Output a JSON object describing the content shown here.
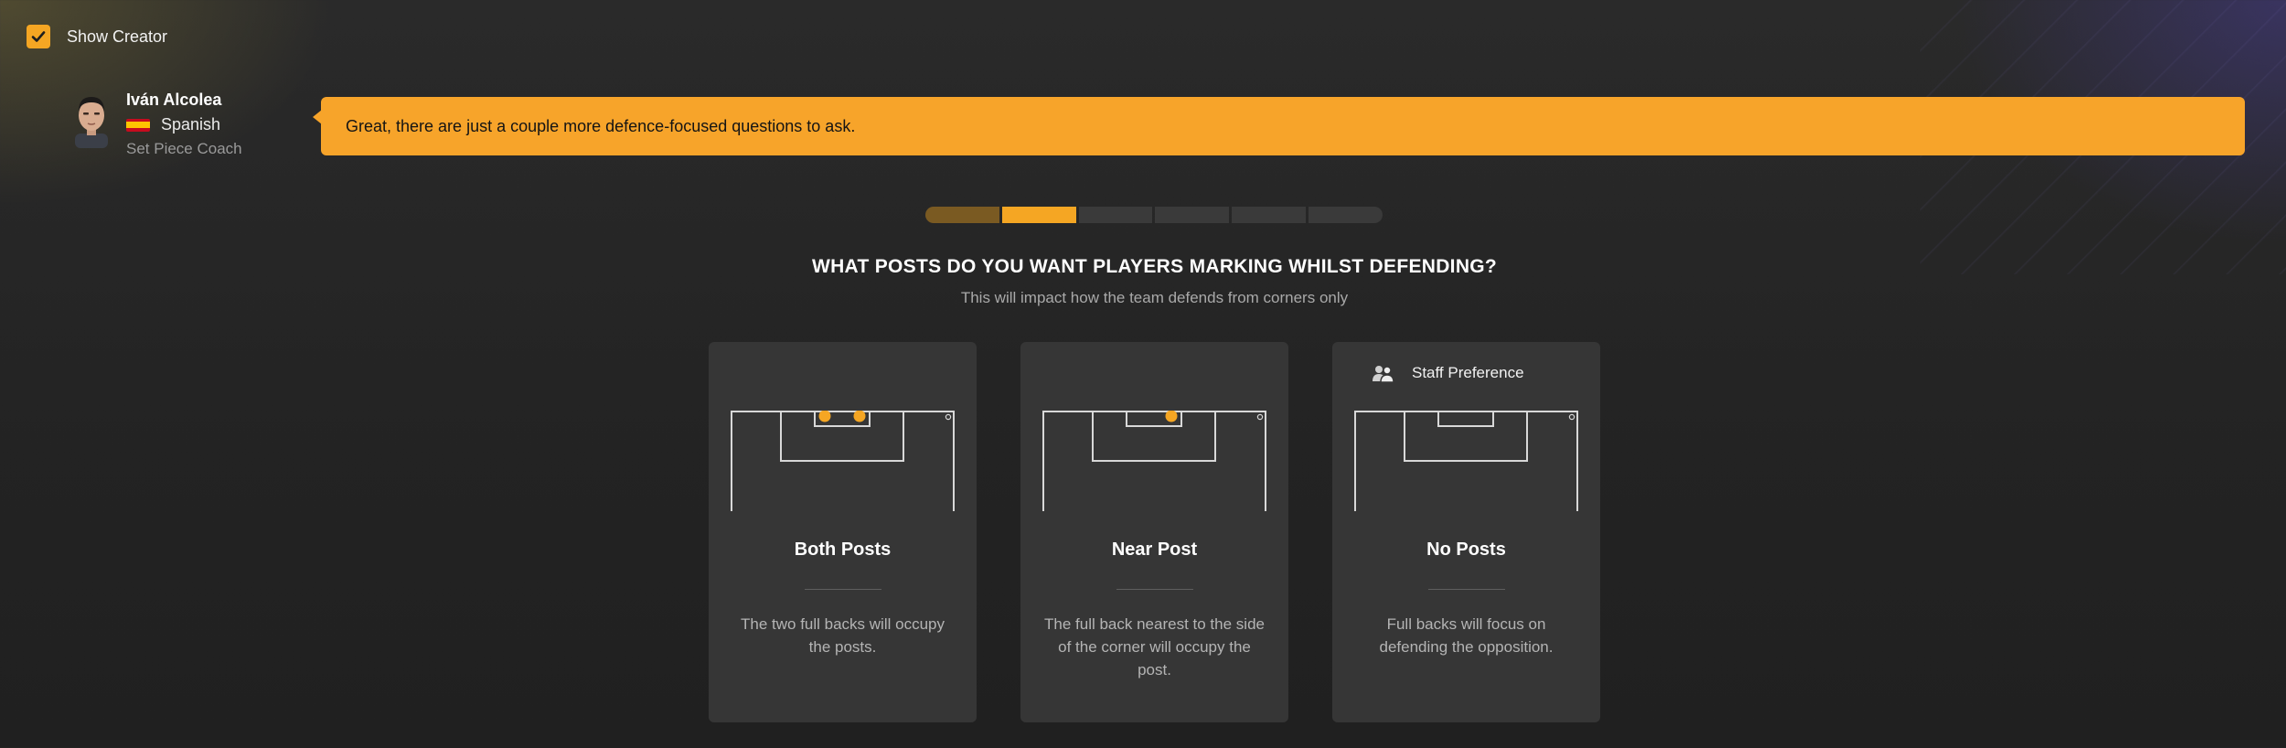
{
  "show_creator": {
    "label": "Show Creator",
    "checked": true
  },
  "coach": {
    "name": "Iván Alcolea",
    "nationality": "Spanish",
    "role": "Set Piece Coach"
  },
  "speech": {
    "text": "Great, there are just a couple more defence-focused questions to ask."
  },
  "progress": {
    "total_steps": 6,
    "current_step": 2
  },
  "question": {
    "title": "WHAT POSTS DO YOU WANT PLAYERS MARKING WHILST DEFENDING?",
    "subtitle": "This will impact how the team defends from corners only"
  },
  "options": [
    {
      "title": "Both Posts",
      "description": "The two full backs will occupy the posts.",
      "markers": 2
    },
    {
      "title": "Near Post",
      "description": "The full back nearest to the side of the corner will occupy the post.",
      "markers": 1
    },
    {
      "title": "No Posts",
      "description": "Full backs will focus on defending the opposition.",
      "markers": 0,
      "badge": "Staff Preference",
      "badge_icon": "staff-icon"
    }
  ],
  "colors": {
    "accent": "#f5a623",
    "card": "#363636",
    "background": "#232323"
  }
}
